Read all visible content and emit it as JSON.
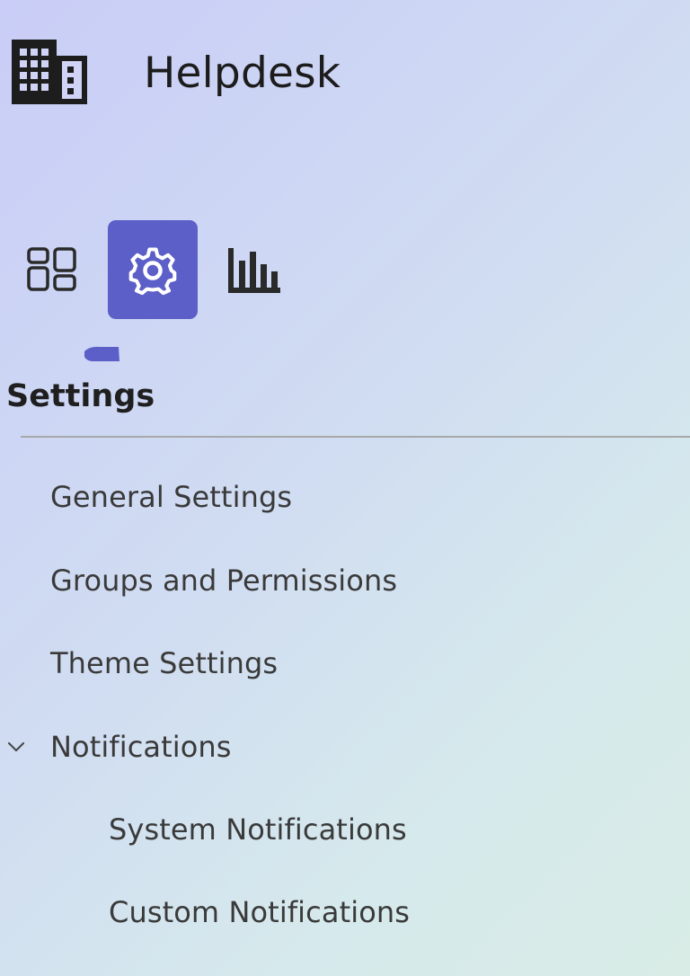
{
  "app": {
    "title": "Helpdesk",
    "logo_icon": "building-icon"
  },
  "nav": {
    "items": [
      {
        "icon": "dashboard-icon",
        "active": false
      },
      {
        "icon": "gear-icon",
        "active": true
      },
      {
        "icon": "bar-chart-icon",
        "active": false
      }
    ],
    "accent_color": "#5b5fc7"
  },
  "section": {
    "title": "Settings"
  },
  "menu": {
    "items": [
      {
        "label": "General Settings"
      },
      {
        "label": "Groups and Permissions"
      },
      {
        "label": "Theme Settings"
      },
      {
        "label": "Notifications",
        "expanded": true,
        "icon": "chevron-down-icon"
      },
      {
        "label": "System Notifications"
      },
      {
        "label": "Custom Notifications"
      }
    ]
  }
}
